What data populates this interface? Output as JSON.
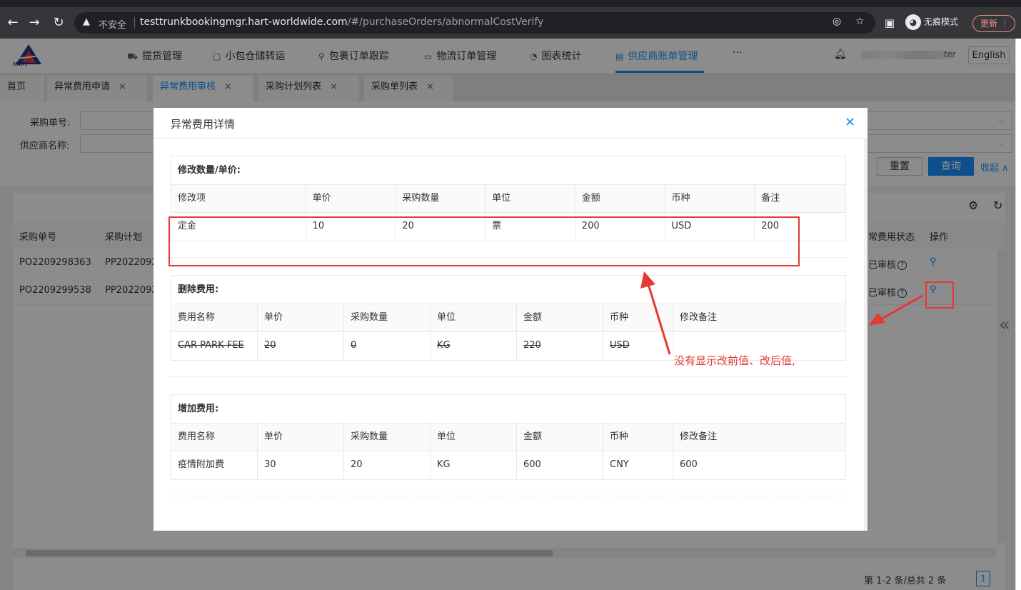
{
  "browser": {
    "insecure_label": "不安全",
    "url_host": "testtrunkbookingmgr.hart-worldwide.com",
    "url_path": "/#/purchaseOrders/abnormalCostVerify",
    "incognito_label": "无痕模式",
    "update_label": "更新"
  },
  "header": {
    "logo_text": "HART",
    "menu": [
      {
        "label": "提货管理",
        "icon": "car-icon"
      },
      {
        "label": "小包仓储转运",
        "icon": "box-icon"
      },
      {
        "label": "包裹订单跟踪",
        "icon": "search-icon"
      },
      {
        "label": "物流订单管理",
        "icon": "folder-icon"
      },
      {
        "label": "图表统计",
        "icon": "chart-icon"
      },
      {
        "label": "供应商账单管理",
        "icon": "bill-icon"
      }
    ],
    "more": "···",
    "user_partial": "ter",
    "lang": "English"
  },
  "tabs": [
    {
      "label": "首页"
    },
    {
      "label": "异常费用申请",
      "close": "×"
    },
    {
      "label": "异常费用审核",
      "close": "×"
    },
    {
      "label": "采购计划列表",
      "close": "×"
    },
    {
      "label": "采购单列表",
      "close": "×"
    }
  ],
  "filters": {
    "po_label": "采购单号:",
    "supplier_label": "供应商名称:",
    "reset": "重置",
    "query": "查询",
    "collapse": "收起"
  },
  "table": {
    "headers": [
      "采购单号",
      "采购计划",
      "常费用状态",
      "操作"
    ],
    "rows": [
      {
        "po": "PO2209298363",
        "plan": "PP2022092",
        "status": "已审核"
      },
      {
        "po": "PO2209299538",
        "plan": "PP2022092",
        "status": "已审核"
      }
    ],
    "pager": "第 1-2 条/总共 2 条",
    "page": "1"
  },
  "modal": {
    "title": "异常费用详情",
    "modify_section": {
      "title": "修改数量/单价:",
      "headers": [
        "修改项",
        "单价",
        "采购数量",
        "单位",
        "金额",
        "币种",
        "备注"
      ],
      "rows": [
        [
          "定金",
          "10",
          "20",
          "票",
          "200",
          "USD",
          "200"
        ]
      ]
    },
    "delete_section": {
      "title": "删除费用:",
      "headers": [
        "费用名称",
        "单价",
        "采购数量",
        "单位",
        "金额",
        "币种",
        "修改备注"
      ],
      "rows": [
        [
          "CAR PARK FEE",
          "20",
          "0",
          "KG",
          "220",
          "USD",
          ""
        ]
      ]
    },
    "add_section": {
      "title": "增加费用:",
      "headers": [
        "费用名称",
        "单价",
        "采购数量",
        "单位",
        "金额",
        "币种",
        "修改备注"
      ],
      "rows": [
        [
          "疫情附加费",
          "30",
          "20",
          "KG",
          "600",
          "CNY",
          "600"
        ]
      ]
    }
  },
  "annotation": {
    "text": "没有显示改前值、改后值,",
    "color": "#e53935"
  }
}
